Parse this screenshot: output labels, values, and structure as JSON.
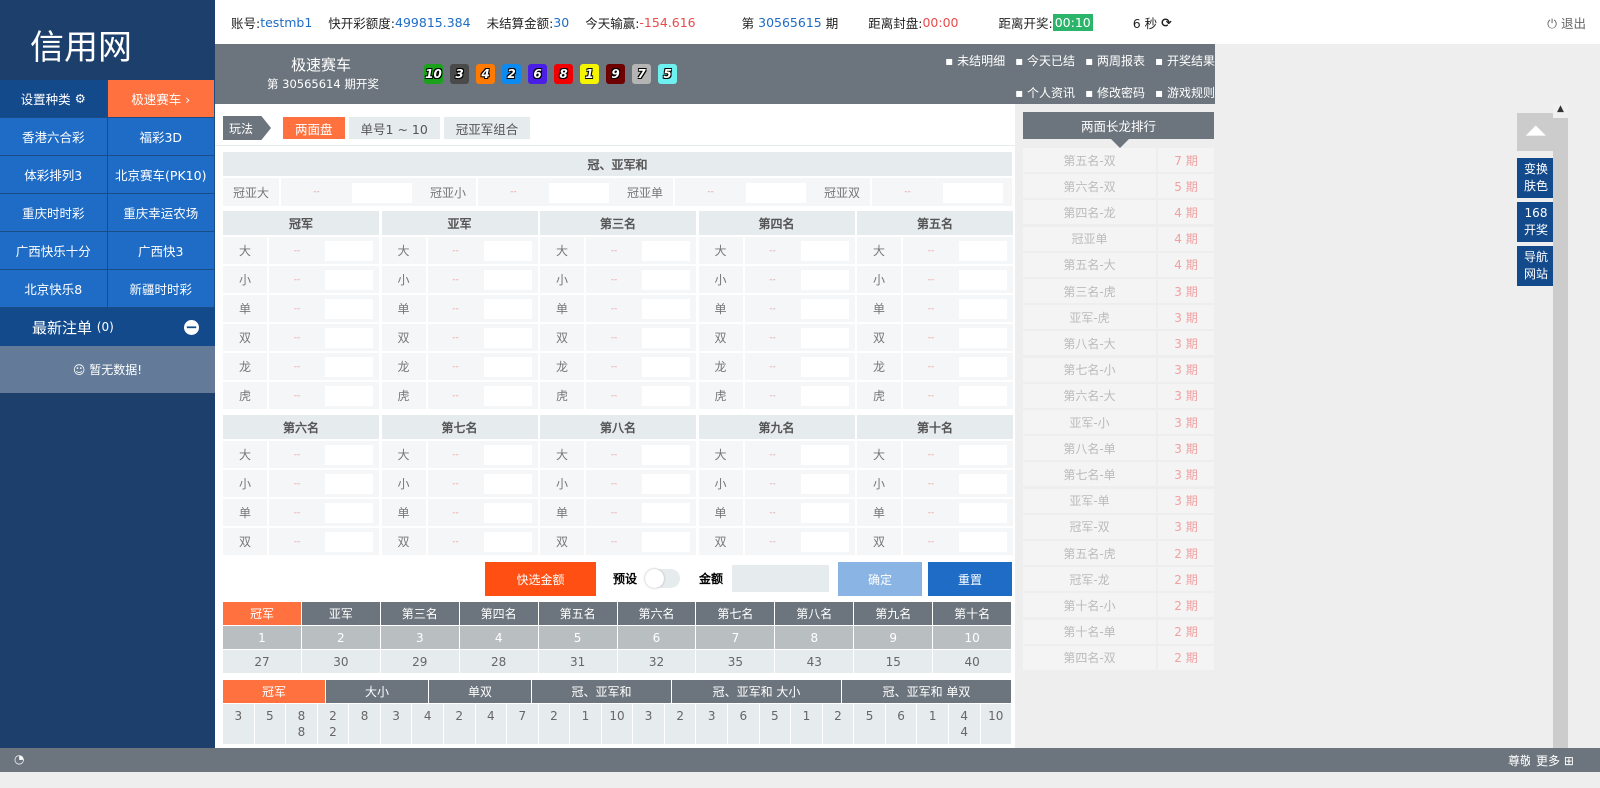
{
  "brand": "信用网",
  "sidebar": {
    "set_kind": "设置种类",
    "current": "极速赛车 ›",
    "games": [
      [
        "香港六合彩",
        "福彩3D"
      ],
      [
        "体彩排列3",
        "北京赛车(PK10)"
      ],
      [
        "重庆时时彩",
        "重庆幸运农场"
      ],
      [
        "广西快乐十分",
        "广西快3"
      ],
      [
        "北京快乐8",
        "新疆时时彩"
      ]
    ],
    "latest_title": "最新注单",
    "latest_count": "(0)",
    "no_data": "☺ 暂无数据!"
  },
  "topbar": {
    "account_label": "账号:",
    "account": "testmb1",
    "credit_label": "快开彩额度:",
    "credit": "499815.384",
    "unsettled_label": "未结算金额:",
    "unsettled": "30",
    "today_label": "今天输赢:",
    "today": "-154.616",
    "period_prefix": "第",
    "period": "30565615",
    "period_suffix": "期",
    "close_label": "距离封盘:",
    "close_time": "00:00",
    "open_label": "距离开奖:",
    "open_time": "00:10",
    "countdown": "6 秒",
    "logout": "退出"
  },
  "game": {
    "name": "极速赛车",
    "last_draw": "第 30565614 期开奖",
    "balls": [
      {
        "n": "10",
        "c": "#1aa31a"
      },
      {
        "n": "3",
        "c": "#4a4a4a"
      },
      {
        "n": "4",
        "c": "#ff7a00"
      },
      {
        "n": "2",
        "c": "#0d8af0"
      },
      {
        "n": "6",
        "c": "#4a1ee6"
      },
      {
        "n": "8",
        "c": "#f00000"
      },
      {
        "n": "1",
        "c": "#f5f500"
      },
      {
        "n": "9",
        "c": "#6e0000"
      },
      {
        "n": "7",
        "c": "#b4b4b4"
      },
      {
        "n": "5",
        "c": "#6ef0f0"
      }
    ],
    "links1": [
      "未结明细",
      "今天已结",
      "两周报表",
      "开奖结果"
    ],
    "links2": [
      "个人资讯",
      "修改密码",
      "游戏规则"
    ]
  },
  "play": {
    "label": "玩法",
    "tabs": [
      "两面盘",
      "单号1 ~ 10",
      "冠亚军组合"
    ]
  },
  "sum": {
    "title": "冠、亚军和",
    "items": [
      "冠亚大",
      "冠亚小",
      "冠亚单",
      "冠亚双"
    ],
    "odds": "--"
  },
  "positions1": [
    "冠军",
    "亚军",
    "第三名",
    "第四名",
    "第五名"
  ],
  "positions2": [
    "第六名",
    "第七名",
    "第八名",
    "第九名",
    "第十名"
  ],
  "options1": [
    "大",
    "小",
    "单",
    "双",
    "龙",
    "虎"
  ],
  "options2": [
    "大",
    "小",
    "单",
    "双"
  ],
  "actions": {
    "quick": "快选金额",
    "preset": "预设",
    "amount": "金额",
    "confirm": "确定",
    "reset": "重置"
  },
  "rank": {
    "headers": [
      "冠军",
      "亚军",
      "第三名",
      "第四名",
      "第五名",
      "第六名",
      "第七名",
      "第八名",
      "第九名",
      "第十名"
    ],
    "nums": [
      "1",
      "2",
      "3",
      "4",
      "5",
      "6",
      "7",
      "8",
      "9",
      "10"
    ],
    "counts": [
      "27",
      "30",
      "29",
      "28",
      "31",
      "32",
      "35",
      "43",
      "15",
      "40"
    ]
  },
  "road": {
    "tabs": [
      "冠军",
      "大小",
      "单双",
      "冠、亚军和",
      "冠、亚军和 大小",
      "冠、亚军和 单双"
    ],
    "cols": [
      [
        "3"
      ],
      [
        "5"
      ],
      [
        "8",
        "8"
      ],
      [
        "2",
        "2"
      ],
      [
        "8"
      ],
      [
        "3"
      ],
      [
        "4"
      ],
      [
        "2"
      ],
      [
        "4"
      ],
      [
        "7"
      ],
      [
        "2"
      ],
      [
        "1"
      ],
      [
        "10"
      ],
      [
        "3"
      ],
      [
        "2"
      ],
      [
        "3"
      ],
      [
        "6"
      ],
      [
        "5"
      ],
      [
        "1"
      ],
      [
        "2"
      ],
      [
        "5"
      ],
      [
        "6"
      ],
      [
        "1"
      ],
      [
        "4",
        "4"
      ],
      [
        "10"
      ]
    ]
  },
  "long": {
    "title": "两面长龙排行",
    "rows": [
      [
        "第五名-双",
        "7 期"
      ],
      [
        "第六名-双",
        "5 期"
      ],
      [
        "第四名-龙",
        "4 期"
      ],
      [
        "冠亚单",
        "4 期"
      ],
      [
        "第五名-大",
        "4 期"
      ],
      [
        "第三名-虎",
        "3 期"
      ],
      [
        "亚军-虎",
        "3 期"
      ],
      [
        "第八名-大",
        "3 期"
      ],
      [
        "第七名-小",
        "3 期"
      ],
      [
        "第六名-大",
        "3 期"
      ],
      [
        "亚军-小",
        "3 期"
      ],
      [
        "第八名-单",
        "3 期"
      ],
      [
        "第七名-单",
        "3 期"
      ],
      [
        "亚军-单",
        "3 期"
      ],
      [
        "冠军-双",
        "3 期"
      ],
      [
        "第五名-虎",
        "2 期"
      ],
      [
        "冠军-龙",
        "2 期"
      ],
      [
        "第十名-小",
        "2 期"
      ],
      [
        "第十名-单",
        "2 期"
      ],
      [
        "第四名-双",
        "2 期"
      ]
    ]
  },
  "side_buttons": [
    "变换\n肤色",
    "168\n开奖",
    "导航\n网站"
  ],
  "footer": {
    "greeting": "尊敬的",
    "more": "更多 ⊞"
  }
}
